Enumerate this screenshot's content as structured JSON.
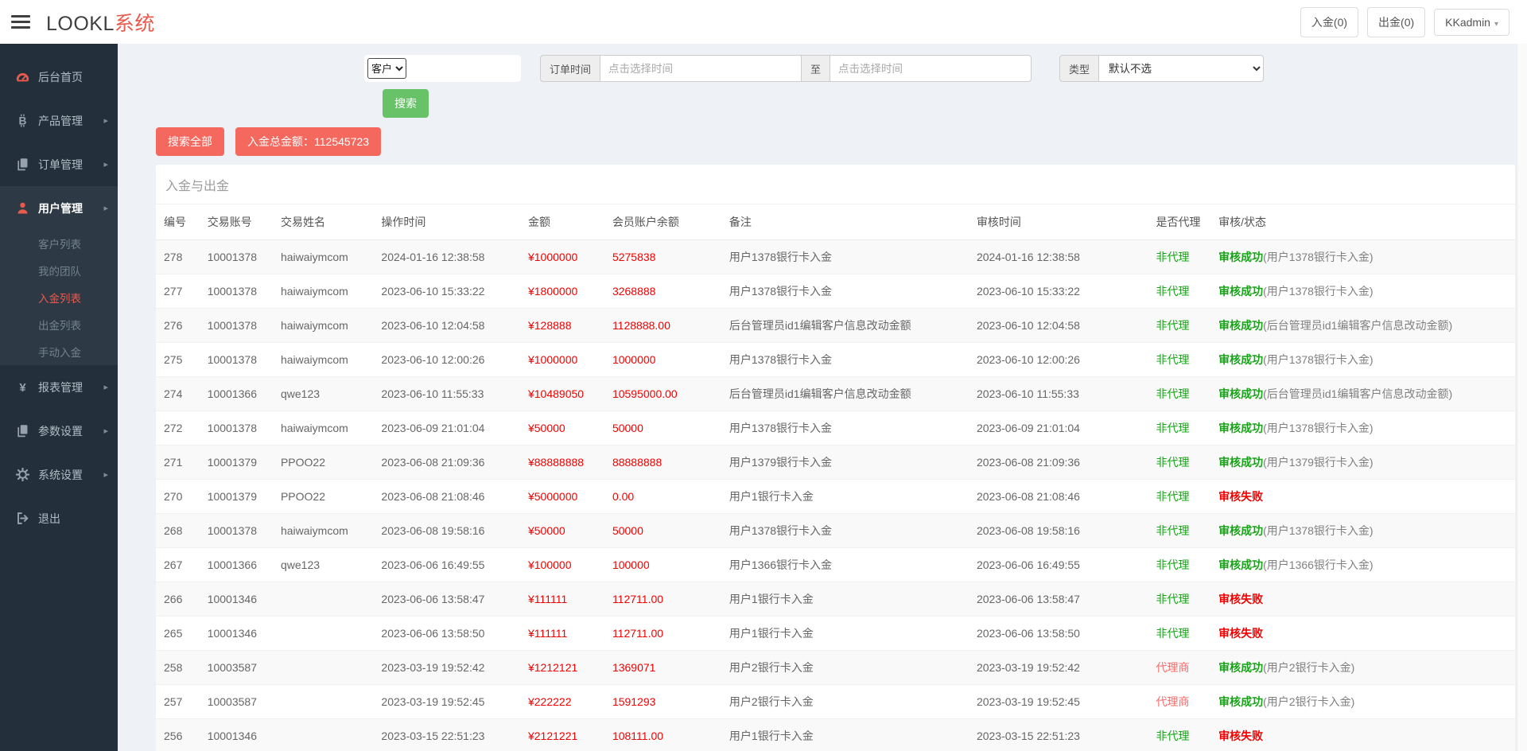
{
  "header": {
    "logo_black": "LOOKL",
    "logo_red": "系统",
    "deposit_btn": "入金(0)",
    "withdraw_btn": "出金(0)",
    "user_menu": "KKadmin"
  },
  "sidebar": {
    "items": [
      {
        "label": "后台首页",
        "icon": "dashboard-icon",
        "icon_red": true,
        "arrow": false
      },
      {
        "label": "产品管理",
        "icon": "bitcoin-icon",
        "icon_red": false,
        "arrow": true
      },
      {
        "label": "订单管理",
        "icon": "files-icon",
        "icon_red": false,
        "arrow": true
      },
      {
        "label": "用户管理",
        "icon": "user-icon",
        "icon_red": true,
        "arrow": true,
        "expanded": true,
        "children": [
          {
            "label": "客户列表",
            "active": false
          },
          {
            "label": "我的团队",
            "active": false
          },
          {
            "label": "入金列表",
            "active": true
          },
          {
            "label": "出金列表",
            "active": false
          },
          {
            "label": "手动入金",
            "active": false
          }
        ]
      },
      {
        "label": "报表管理",
        "icon": "yen-icon",
        "icon_red": false,
        "arrow": true
      },
      {
        "label": "参数设置",
        "icon": "files-icon",
        "icon_red": false,
        "arrow": true
      },
      {
        "label": "系统设置",
        "icon": "gears-icon",
        "icon_red": false,
        "arrow": true
      },
      {
        "label": "退出",
        "icon": "logout-icon",
        "icon_red": false,
        "arrow": false
      }
    ]
  },
  "filters": {
    "field_select": "客户",
    "field_value": "",
    "order_time_label": "订单时间",
    "time_placeholder": "点击选择时间",
    "to_label": "至",
    "type_label": "类型",
    "type_select": "默认不选",
    "search_btn": "搜索",
    "search_all_btn": "搜索全部",
    "total_label": "入金总金额：112545723"
  },
  "panel": {
    "title": "入金与出金",
    "columns": [
      "编号",
      "交易账号",
      "交易姓名",
      "操作时间",
      "金额",
      "会员账户余额",
      "备注",
      "审核时间",
      "是否代理",
      "审核/状态"
    ],
    "rows": [
      {
        "id": "278",
        "account": "10001378",
        "name": "haiwaiymcom",
        "op_time": "2024-01-16 12:38:58",
        "amount": "¥1000000",
        "balance": "5275838",
        "remark": "用户1378银行卡入金",
        "audit_time": "2024-01-16 12:38:58",
        "agent": "非代理",
        "agent_style": "green",
        "status": "审核成功",
        "status_ok": true,
        "note": "(用户1378银行卡入金)"
      },
      {
        "id": "277",
        "account": "10001378",
        "name": "haiwaiymcom",
        "op_time": "2023-06-10 15:33:22",
        "amount": "¥1800000",
        "balance": "3268888",
        "remark": "用户1378银行卡入金",
        "audit_time": "2023-06-10 15:33:22",
        "agent": "非代理",
        "agent_style": "green",
        "status": "审核成功",
        "status_ok": true,
        "note": "(用户1378银行卡入金)"
      },
      {
        "id": "276",
        "account": "10001378",
        "name": "haiwaiymcom",
        "op_time": "2023-06-10 12:04:58",
        "amount": "¥128888",
        "balance": "1128888.00",
        "remark": "后台管理员id1编辑客户信息改动金额",
        "audit_time": "2023-06-10 12:04:58",
        "agent": "非代理",
        "agent_style": "green",
        "status": "审核成功",
        "status_ok": true,
        "note": "(后台管理员id1编辑客户信息改动金额)"
      },
      {
        "id": "275",
        "account": "10001378",
        "name": "haiwaiymcom",
        "op_time": "2023-06-10 12:00:26",
        "amount": "¥1000000",
        "balance": "1000000",
        "remark": "用户1378银行卡入金",
        "audit_time": "2023-06-10 12:00:26",
        "agent": "非代理",
        "agent_style": "green",
        "status": "审核成功",
        "status_ok": true,
        "note": "(用户1378银行卡入金)"
      },
      {
        "id": "274",
        "account": "10001366",
        "name": "qwe123",
        "op_time": "2023-06-10 11:55:33",
        "amount": "¥10489050",
        "balance": "10595000.00",
        "remark": "后台管理员id1编辑客户信息改动金额",
        "audit_time": "2023-06-10 11:55:33",
        "agent": "非代理",
        "agent_style": "green",
        "status": "审核成功",
        "status_ok": true,
        "note": "(后台管理员id1编辑客户信息改动金额)"
      },
      {
        "id": "272",
        "account": "10001378",
        "name": "haiwaiymcom",
        "op_time": "2023-06-09 21:01:04",
        "amount": "¥50000",
        "balance": "50000",
        "remark": "用户1378银行卡入金",
        "audit_time": "2023-06-09 21:01:04",
        "agent": "非代理",
        "agent_style": "green",
        "status": "审核成功",
        "status_ok": true,
        "note": "(用户1378银行卡入金)"
      },
      {
        "id": "271",
        "account": "10001379",
        "name": "PPOO22",
        "op_time": "2023-06-08 21:09:36",
        "amount": "¥88888888",
        "balance": "88888888",
        "remark": "用户1379银行卡入金",
        "audit_time": "2023-06-08 21:09:36",
        "agent": "非代理",
        "agent_style": "green",
        "status": "审核成功",
        "status_ok": true,
        "note": "(用户1379银行卡入金)"
      },
      {
        "id": "270",
        "account": "10001379",
        "name": "PPOO22",
        "op_time": "2023-06-08 21:08:46",
        "amount": "¥5000000",
        "balance": "0.00",
        "remark": "用户1银行卡入金",
        "audit_time": "2023-06-08 21:08:46",
        "agent": "非代理",
        "agent_style": "green",
        "status": "审核失败",
        "status_ok": false,
        "note": ""
      },
      {
        "id": "268",
        "account": "10001378",
        "name": "haiwaiymcom",
        "op_time": "2023-06-08 19:58:16",
        "amount": "¥50000",
        "balance": "50000",
        "remark": "用户1378银行卡入金",
        "audit_time": "2023-06-08 19:58:16",
        "agent": "非代理",
        "agent_style": "green",
        "status": "审核成功",
        "status_ok": true,
        "note": "(用户1378银行卡入金)"
      },
      {
        "id": "267",
        "account": "10001366",
        "name": "qwe123",
        "op_time": "2023-06-06 16:49:55",
        "amount": "¥100000",
        "balance": "100000",
        "remark": "用户1366银行卡入金",
        "audit_time": "2023-06-06 16:49:55",
        "agent": "非代理",
        "agent_style": "green",
        "status": "审核成功",
        "status_ok": true,
        "note": "(用户1366银行卡入金)"
      },
      {
        "id": "266",
        "account": "10001346",
        "name": "",
        "op_time": "2023-06-06 13:58:47",
        "amount": "¥111111",
        "balance": "112711.00",
        "remark": "用户1银行卡入金",
        "audit_time": "2023-06-06 13:58:47",
        "agent": "非代理",
        "agent_style": "green",
        "status": "审核失败",
        "status_ok": false,
        "note": ""
      },
      {
        "id": "265",
        "account": "10001346",
        "name": "",
        "op_time": "2023-06-06 13:58:50",
        "amount": "¥111111",
        "balance": "112711.00",
        "remark": "用户1银行卡入金",
        "audit_time": "2023-06-06 13:58:50",
        "agent": "非代理",
        "agent_style": "green",
        "status": "审核失败",
        "status_ok": false,
        "note": ""
      },
      {
        "id": "258",
        "account": "10003587",
        "name": "",
        "op_time": "2023-03-19 19:52:42",
        "amount": "¥1212121",
        "balance": "1369071",
        "remark": "用户2银行卡入金",
        "audit_time": "2023-03-19 19:52:42",
        "agent": "代理商",
        "agent_style": "red",
        "status": "审核成功",
        "status_ok": true,
        "note": "(用户2银行卡入金)"
      },
      {
        "id": "257",
        "account": "10003587",
        "name": "",
        "op_time": "2023-03-19 19:52:45",
        "amount": "¥222222",
        "balance": "1591293",
        "remark": "用户2银行卡入金",
        "audit_time": "2023-03-19 19:52:45",
        "agent": "代理商",
        "agent_style": "red",
        "status": "审核成功",
        "status_ok": true,
        "note": "(用户2银行卡入金)"
      },
      {
        "id": "256",
        "account": "10001346",
        "name": "",
        "op_time": "2023-03-15 22:51:23",
        "amount": "¥2121221",
        "balance": "108111.00",
        "remark": "用户1银行卡入金",
        "audit_time": "2023-03-15 22:51:23",
        "agent": "非代理",
        "agent_style": "green",
        "status": "审核失败",
        "status_ok": false,
        "note": ""
      }
    ]
  },
  "colors": {
    "accent_red": "#e9594c",
    "amount_red": "#f30000",
    "success_green": "#18a318",
    "agent_red": "#f56c6c",
    "button_green": "#68c368",
    "button_red": "#f4685e",
    "sidebar_bg": "#232f3a",
    "submenu_bg": "#2d3945"
  }
}
